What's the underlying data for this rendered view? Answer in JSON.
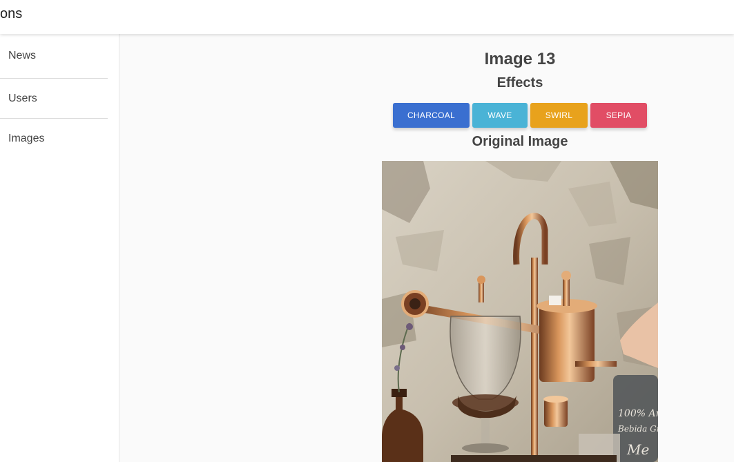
{
  "app": {
    "title_fragment": "ons"
  },
  "sidebar": {
    "items": [
      {
        "label": "News"
      },
      {
        "label": "Users"
      },
      {
        "label": "Images"
      }
    ]
  },
  "main": {
    "image_title": "Image 13",
    "effects_heading": "Effects",
    "effects": [
      {
        "label": "CHARCOAL",
        "color": "#3a6fd0"
      },
      {
        "label": "WAVE",
        "color": "#4ab3d6"
      },
      {
        "label": "SWIRL",
        "color": "#e8a21c"
      },
      {
        "label": "SEPIA",
        "color": "#e14d65"
      }
    ],
    "original_heading": "Original Image",
    "photo_icon": "coffee-siphon-photo"
  }
}
